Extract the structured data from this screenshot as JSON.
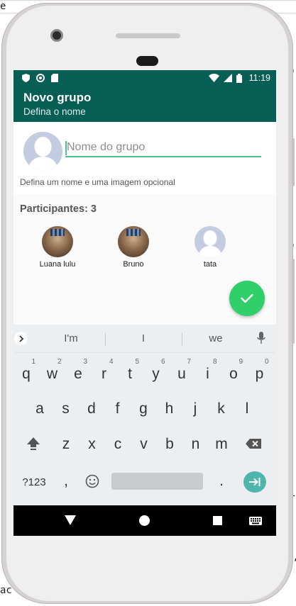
{
  "background": {
    "line_fragments": [
      "e",
      "p",
      "i",
      "v",
      "C",
      "J,",
      "ac"
    ]
  },
  "status_bar": {
    "time": "11:19",
    "icons": [
      "shield-icon",
      "record-icon",
      "sd-card-icon",
      "wifi-icon",
      "signal-icon",
      "battery-icon"
    ]
  },
  "app_bar": {
    "title": "Novo grupo",
    "subtitle": "Defina o nome",
    "color": "#075e54"
  },
  "group_form": {
    "name_placeholder": "Nome do grupo",
    "name_value": "",
    "hint": "Defina um nome e uma imagem opcional",
    "accent_color": "#4cc38a"
  },
  "participants": {
    "header": "Participantes: 3",
    "people": [
      {
        "name": "Luana lulu",
        "avatar": "photo"
      },
      {
        "name": "Bruno",
        "avatar": "photo"
      },
      {
        "name": "tata",
        "avatar": "default"
      }
    ]
  },
  "fab": {
    "icon": "check-icon",
    "color": "#2fd06a"
  },
  "keyboard": {
    "suggestions": [
      "I'm",
      "I",
      "we"
    ],
    "row1": [
      {
        "k": "q",
        "n": "1"
      },
      {
        "k": "w",
        "n": "2"
      },
      {
        "k": "e",
        "n": "3"
      },
      {
        "k": "r",
        "n": "4"
      },
      {
        "k": "t",
        "n": "5"
      },
      {
        "k": "y",
        "n": "6"
      },
      {
        "k": "u",
        "n": "7"
      },
      {
        "k": "i",
        "n": "8"
      },
      {
        "k": "o",
        "n": "9"
      },
      {
        "k": "p",
        "n": "0"
      }
    ],
    "row2": [
      "a",
      "s",
      "d",
      "f",
      "g",
      "h",
      "j",
      "k",
      "l"
    ],
    "row3": [
      "z",
      "x",
      "c",
      "v",
      "b",
      "n",
      "m"
    ],
    "symbols_key": "?123",
    "comma_key": ",",
    "period_key": ".",
    "enter_color": "#4db6ac"
  }
}
